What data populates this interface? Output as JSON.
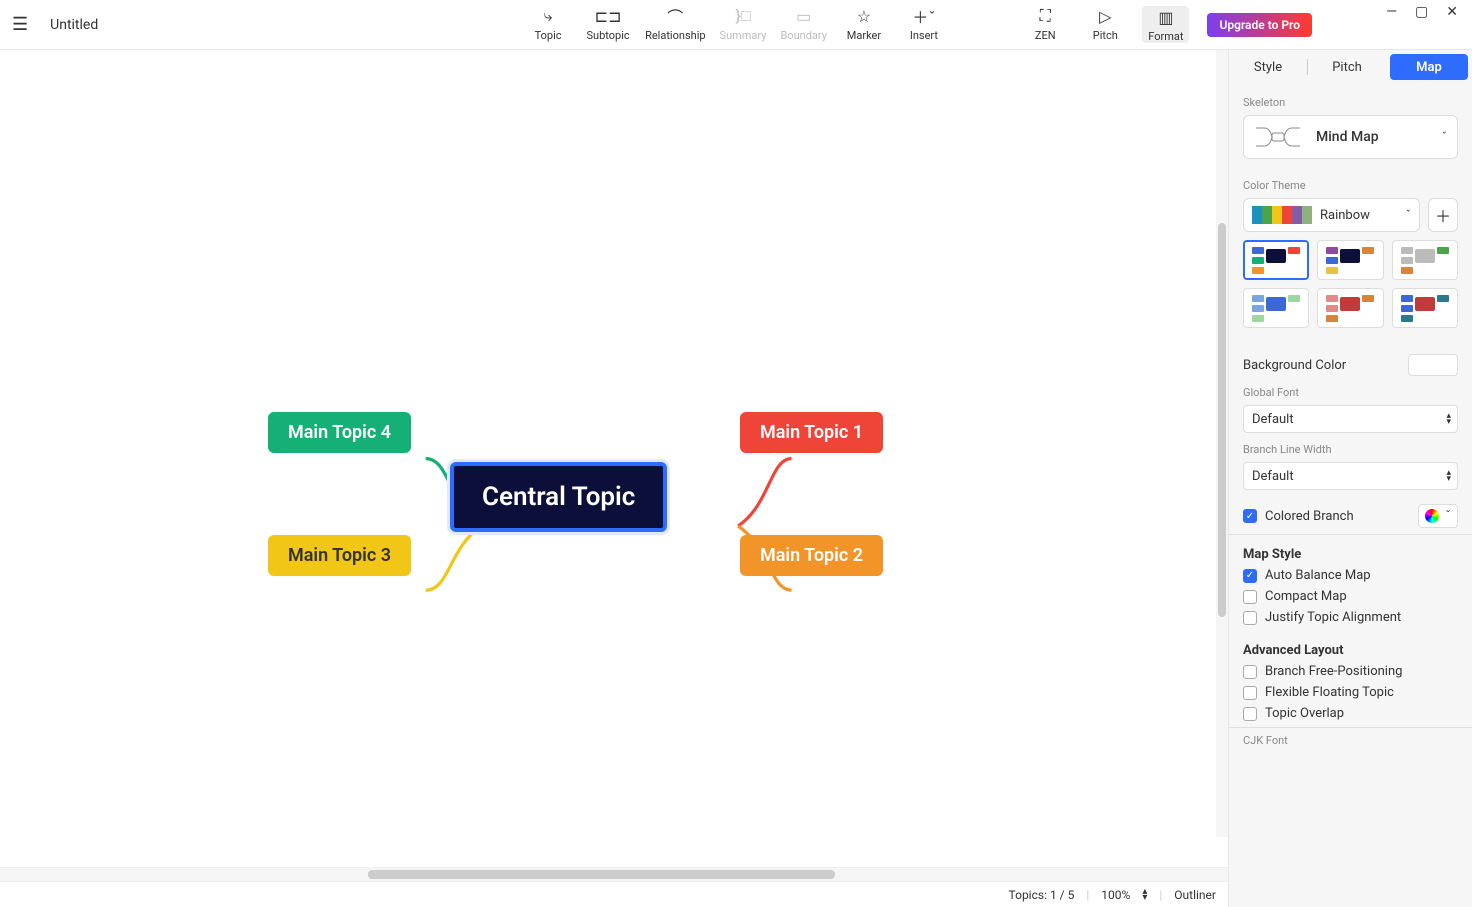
{
  "window": {
    "title": "Untitled"
  },
  "toolbar": {
    "topic": "Topic",
    "subtopic": "Subtopic",
    "relationship": "Relationship",
    "summary": "Summary",
    "boundary": "Boundary",
    "marker": "Marker",
    "insert": "Insert",
    "zen": "ZEN",
    "pitch": "Pitch",
    "format": "Format",
    "upgrade": "Upgrade to Pro"
  },
  "mindmap": {
    "central": "Central Topic",
    "topics": [
      {
        "label": "Main Topic 1",
        "color": "#ef4539"
      },
      {
        "label": "Main Topic 2",
        "color": "#f29427"
      },
      {
        "label": "Main Topic 3",
        "color": "#f2c617"
      },
      {
        "label": "Main Topic 4",
        "color": "#15b076"
      }
    ]
  },
  "panel": {
    "tabs": {
      "style": "Style",
      "pitch": "Pitch",
      "map": "Map"
    },
    "skeleton_label": "Skeleton",
    "skeleton_value": "Mind Map",
    "color_theme_label": "Color Theme",
    "color_theme_value": "Rainbow",
    "background_label": "Background Color",
    "global_font_label": "Global Font",
    "global_font_value": "Default",
    "branch_width_label": "Branch Line Width",
    "branch_width_value": "Default",
    "colored_branch_label": "Colored Branch",
    "map_style_title": "Map Style",
    "auto_balance": "Auto Balance Map",
    "compact": "Compact Map",
    "justify": "Justify Topic Alignment",
    "advanced_title": "Advanced Layout",
    "branch_free": "Branch Free-Positioning",
    "flexible_floating": "Flexible Floating Topic",
    "topic_overlap": "Topic Overlap",
    "cjk_font_label": "CJK Font"
  },
  "status": {
    "topics": "Topics: 1 / 5",
    "zoom": "100%",
    "outliner": "Outliner"
  },
  "colors": {
    "rainbow_strip": [
      "#1d91c0",
      "#4ba34a",
      "#f2c617",
      "#ef4539",
      "#825da6",
      "#8db17f"
    ]
  }
}
